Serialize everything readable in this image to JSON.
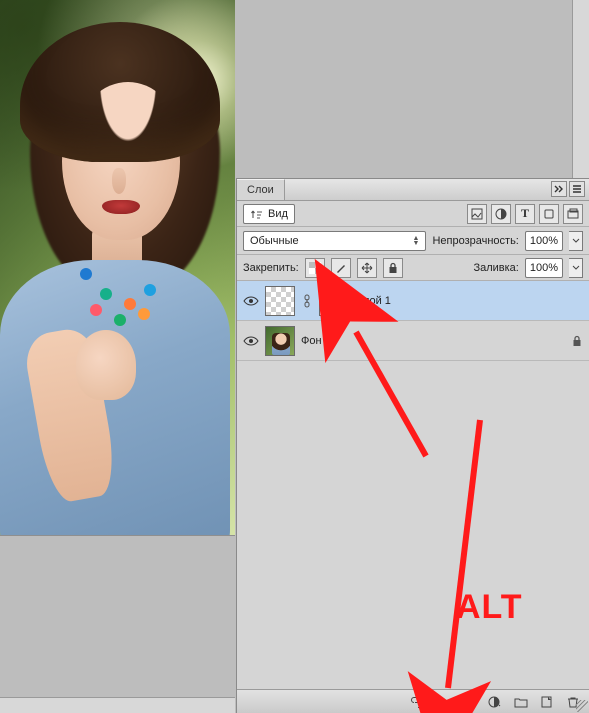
{
  "panel": {
    "tab_title": "Слои",
    "filter_label": "Вид",
    "blend_mode": "Обычные",
    "opacity_label": "Непрозрачность:",
    "opacity_value": "100%",
    "lock_label": "Закрепить:",
    "fill_label": "Заливка:",
    "fill_value": "100%"
  },
  "layers": [
    {
      "name": "Слой 1",
      "visible": true,
      "selected": true,
      "has_mask": true,
      "locked": false
    },
    {
      "name": "Фон",
      "visible": true,
      "selected": false,
      "has_mask": false,
      "locked": true
    }
  ],
  "annotation": {
    "text": "ALT"
  },
  "icons": {
    "eye": "eye-icon",
    "lock": "lock-icon"
  }
}
